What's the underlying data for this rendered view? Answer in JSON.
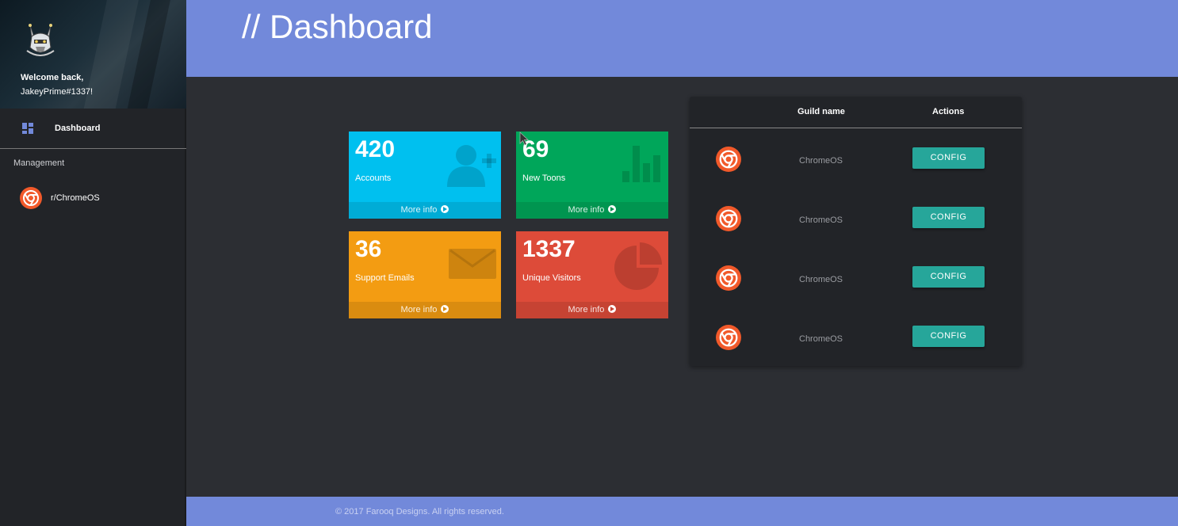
{
  "sidebar": {
    "welcome_line1": "Welcome back,",
    "username": "JakeyPrime#1337!",
    "nav_dashboard": "Dashboard",
    "section_management": "Management",
    "guild_item": "r/ChromeOS"
  },
  "header": {
    "title": "// Dashboard"
  },
  "stats": [
    {
      "value": "420",
      "label": "Accounts",
      "footer": "More info",
      "color": "#00c0ef",
      "icon": "add-user-icon"
    },
    {
      "value": "69",
      "label": "New Toons",
      "footer": "More info",
      "color": "#00a65a",
      "icon": "bar-chart-icon"
    },
    {
      "value": "36",
      "label": "Support Emails",
      "footer": "More info",
      "color": "#f39c12",
      "icon": "envelope-icon"
    },
    {
      "value": "1337",
      "label": "Unique Visitors",
      "footer": "More info",
      "color": "#dd4b39",
      "icon": "pie-chart-icon"
    }
  ],
  "guild_table": {
    "headers": {
      "name": "Guild name",
      "actions": "Actions"
    },
    "rows": [
      {
        "name": "ChromeOS",
        "action": "CONFIG",
        "icon": "chrome-icon"
      },
      {
        "name": "ChromeOS",
        "action": "CONFIG",
        "icon": "chrome-icon"
      },
      {
        "name": "ChromeOS",
        "action": "CONFIG",
        "icon": "chrome-icon"
      },
      {
        "name": "ChromeOS",
        "action": "CONFIG",
        "icon": "chrome-icon"
      }
    ]
  },
  "footer": {
    "copyright": "© 2017 Farooq Designs. All rights reserved."
  },
  "colors": {
    "accent": "#7289da",
    "config_button": "#26a69a",
    "background": "#2c2e33",
    "sidebar": "#222428"
  }
}
